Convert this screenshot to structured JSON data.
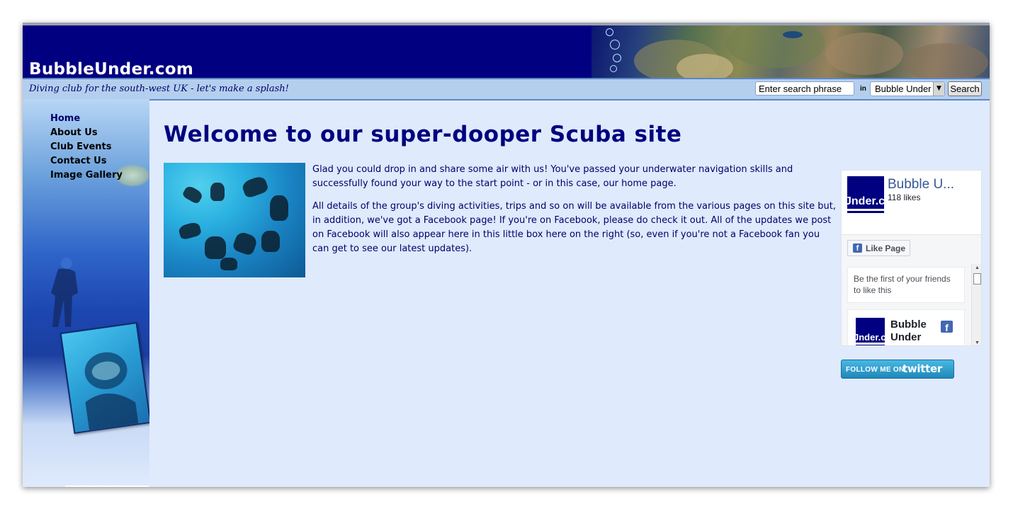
{
  "site": {
    "name": "BubbleUnder.com",
    "tagline": "Diving club for the south-west UK - let's make a splash!"
  },
  "search": {
    "placeholder": "Enter search phrase",
    "in_label": "in",
    "scope_selected": "Bubble Under",
    "button_label": "Search"
  },
  "nav": {
    "items": [
      {
        "label": "Home",
        "current": true
      },
      {
        "label": "About Us"
      },
      {
        "label": "Club Events"
      },
      {
        "label": "Contact Us"
      },
      {
        "label": "Image Gallery"
      }
    ]
  },
  "main": {
    "heading": "Welcome to our super-dooper Scuba site",
    "paragraphs": [
      "Glad you could drop in and share some air with us! You've passed your underwater navigation skills and successfully found your way to the start point - or in this case, our home page.",
      "All details of the group's diving activities, trips and so on will be available from the various pages on this site but, in addition, we've got a Facebook page! If you're on Facebook, please do check it out. All of the updates we post on Facebook will also appear here in this little box here on the right (so, even if you're not a Facebook fan you can get to see our latest updates)."
    ]
  },
  "facebook": {
    "page_name": "Bubble U...",
    "logo_text": "Jnder.c",
    "likes": "118 likes",
    "like_button": "Like Page",
    "friends_text": "Be the first of your friends to like this",
    "post_name": "Bubble Under",
    "icon": "facebook-icon"
  },
  "twitter": {
    "follow_text": "FOLLOW ME ON",
    "brand": "twitter"
  },
  "colors": {
    "header": "#000080",
    "body_bg": "#dfeafc",
    "heading": "#000080",
    "text": "#00006b"
  }
}
